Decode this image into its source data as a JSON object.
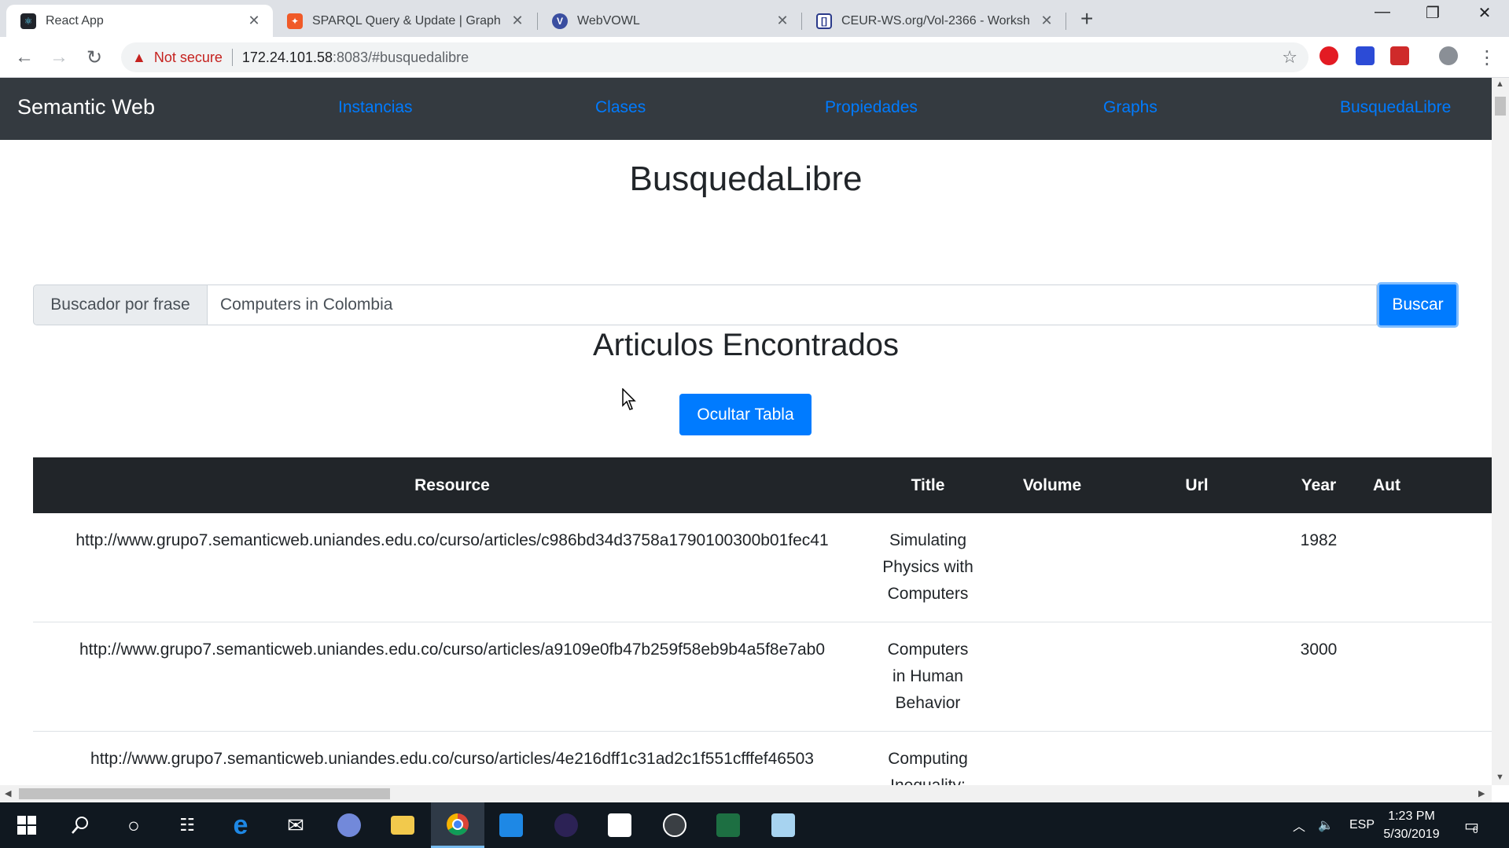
{
  "browser": {
    "tabs": [
      {
        "title": "React App",
        "favicon": "react-icon",
        "active": true
      },
      {
        "title": "SPARQL Query & Update | Graph",
        "favicon": "graphdb-icon",
        "active": false
      },
      {
        "title": "WebVOWL",
        "favicon": "webvowl-icon",
        "active": false
      },
      {
        "title": "CEUR-WS.org/Vol-2366 - Worksh",
        "favicon": "ceur-icon",
        "active": false
      }
    ],
    "security_label": "Not secure",
    "url_host": "172.24.101.58",
    "url_rest": ":8083/#busquedalibre"
  },
  "navbar": {
    "brand": "Semantic Web",
    "links": [
      "Instancias",
      "Clases",
      "Propiedades",
      "Graphs",
      "BusquedaLibre"
    ]
  },
  "main": {
    "title": "BusquedaLibre",
    "search": {
      "label": "Buscador por frase",
      "value": "Computers in Colombia",
      "button": "Buscar"
    },
    "results_title": "Articulos Encontrados",
    "toggle_button": "Ocultar Tabla",
    "table": {
      "headers": [
        "Resource",
        "Title",
        "Volume",
        "Url",
        "Year",
        "Aut"
      ],
      "rows": [
        [
          "http://www.grupo7.semanticweb.uniandes.edu.co/curso/articles/c986bd34d3758a1790100300b01fec41",
          "Simulating Physics with Computers",
          "",
          "",
          "1982",
          ""
        ],
        [
          "http://www.grupo7.semanticweb.uniandes.edu.co/curso/articles/a9109e0fb47b259f58eb9b4a5f8e7ab0",
          "Computers in Human Behavior",
          "",
          "",
          "3000",
          ""
        ],
        [
          "http://www.grupo7.semanticweb.uniandes.edu.co/curso/articles/4e216dff1c31ad2c1f551cfffef46503",
          "Computing Inequality: Have Computers",
          "",
          "",
          "",
          ""
        ]
      ]
    }
  },
  "taskbar": {
    "language": "ESP",
    "time": "1:23 PM",
    "date": "5/30/2019",
    "notifications": "6"
  },
  "colors": {
    "navbar_bg": "#343a40",
    "link": "#007bff",
    "primary": "#007bff",
    "table_head": "#212529",
    "danger": "#c5221f"
  }
}
